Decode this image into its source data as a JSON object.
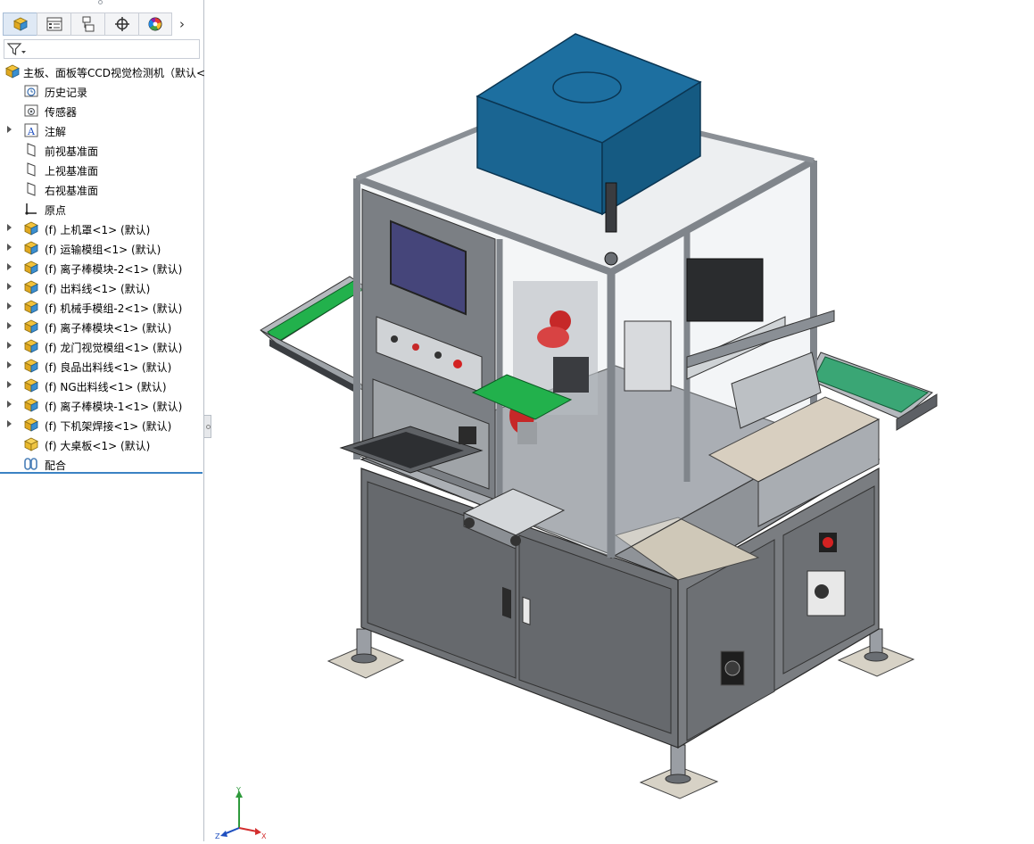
{
  "tabs": [
    {
      "name": "feature-manager"
    },
    {
      "name": "property-manager"
    },
    {
      "name": "configuration-manager"
    },
    {
      "name": "dimxpert-manager"
    },
    {
      "name": "display-manager"
    }
  ],
  "tab_more": "›",
  "filter": {
    "icon": "filter-icon"
  },
  "tree": {
    "root": {
      "label": "主板、面板等CCD视觉检测机（默认<"
    },
    "items": [
      {
        "label": "历史记录",
        "icon": "history-icon",
        "expand": false
      },
      {
        "label": "传感器",
        "icon": "sensor-icon",
        "expand": false
      },
      {
        "label": "注解",
        "icon": "annotation-icon",
        "expand": true
      },
      {
        "label": "前视基准面",
        "icon": "plane-icon",
        "expand": false
      },
      {
        "label": "上视基准面",
        "icon": "plane-icon",
        "expand": false
      },
      {
        "label": "右视基准面",
        "icon": "plane-icon",
        "expand": false
      },
      {
        "label": "原点",
        "icon": "origin-icon",
        "expand": false
      },
      {
        "label": "(f) 上机罩<1> (默认)",
        "icon": "subassembly-icon",
        "expand": true
      },
      {
        "label": "(f) 运输模组<1> (默认)",
        "icon": "subassembly-icon",
        "expand": true
      },
      {
        "label": "(f) 离子棒模块-2<1> (默认)",
        "icon": "subassembly-icon",
        "expand": true
      },
      {
        "label": "(f) 出料线<1> (默认)",
        "icon": "subassembly-icon",
        "expand": true
      },
      {
        "label": "(f) 机械手模组-2<1> (默认)",
        "icon": "subassembly-icon",
        "expand": true
      },
      {
        "label": "(f) 离子棒模块<1> (默认)",
        "icon": "subassembly-icon",
        "expand": true
      },
      {
        "label": "(f) 龙门视觉模组<1> (默认)",
        "icon": "subassembly-icon",
        "expand": true
      },
      {
        "label": "(f) 良品出料线<1> (默认)",
        "icon": "subassembly-icon",
        "expand": true
      },
      {
        "label": "(f) NG出料线<1> (默认)",
        "icon": "subassembly-icon",
        "expand": true
      },
      {
        "label": "(f) 离子棒模块-1<1> (默认)",
        "icon": "subassembly-icon",
        "expand": true
      },
      {
        "label": "(f) 下机架焊接<1> (默认)",
        "icon": "subassembly-icon",
        "expand": true
      },
      {
        "label": "(f) 大桌板<1> (默认)",
        "icon": "part-icon",
        "expand": false
      },
      {
        "label": "配合",
        "icon": "mates-icon",
        "expand": false
      }
    ]
  },
  "triad": {
    "x": "X",
    "y": "Y",
    "z": "Z"
  },
  "colors": {
    "accent": "#3b82c4",
    "cover_blue": "#1d6fa0",
    "frame": "#8c9096",
    "cabinet": "#6b6e72",
    "conveyor_green": "#22b14c"
  }
}
